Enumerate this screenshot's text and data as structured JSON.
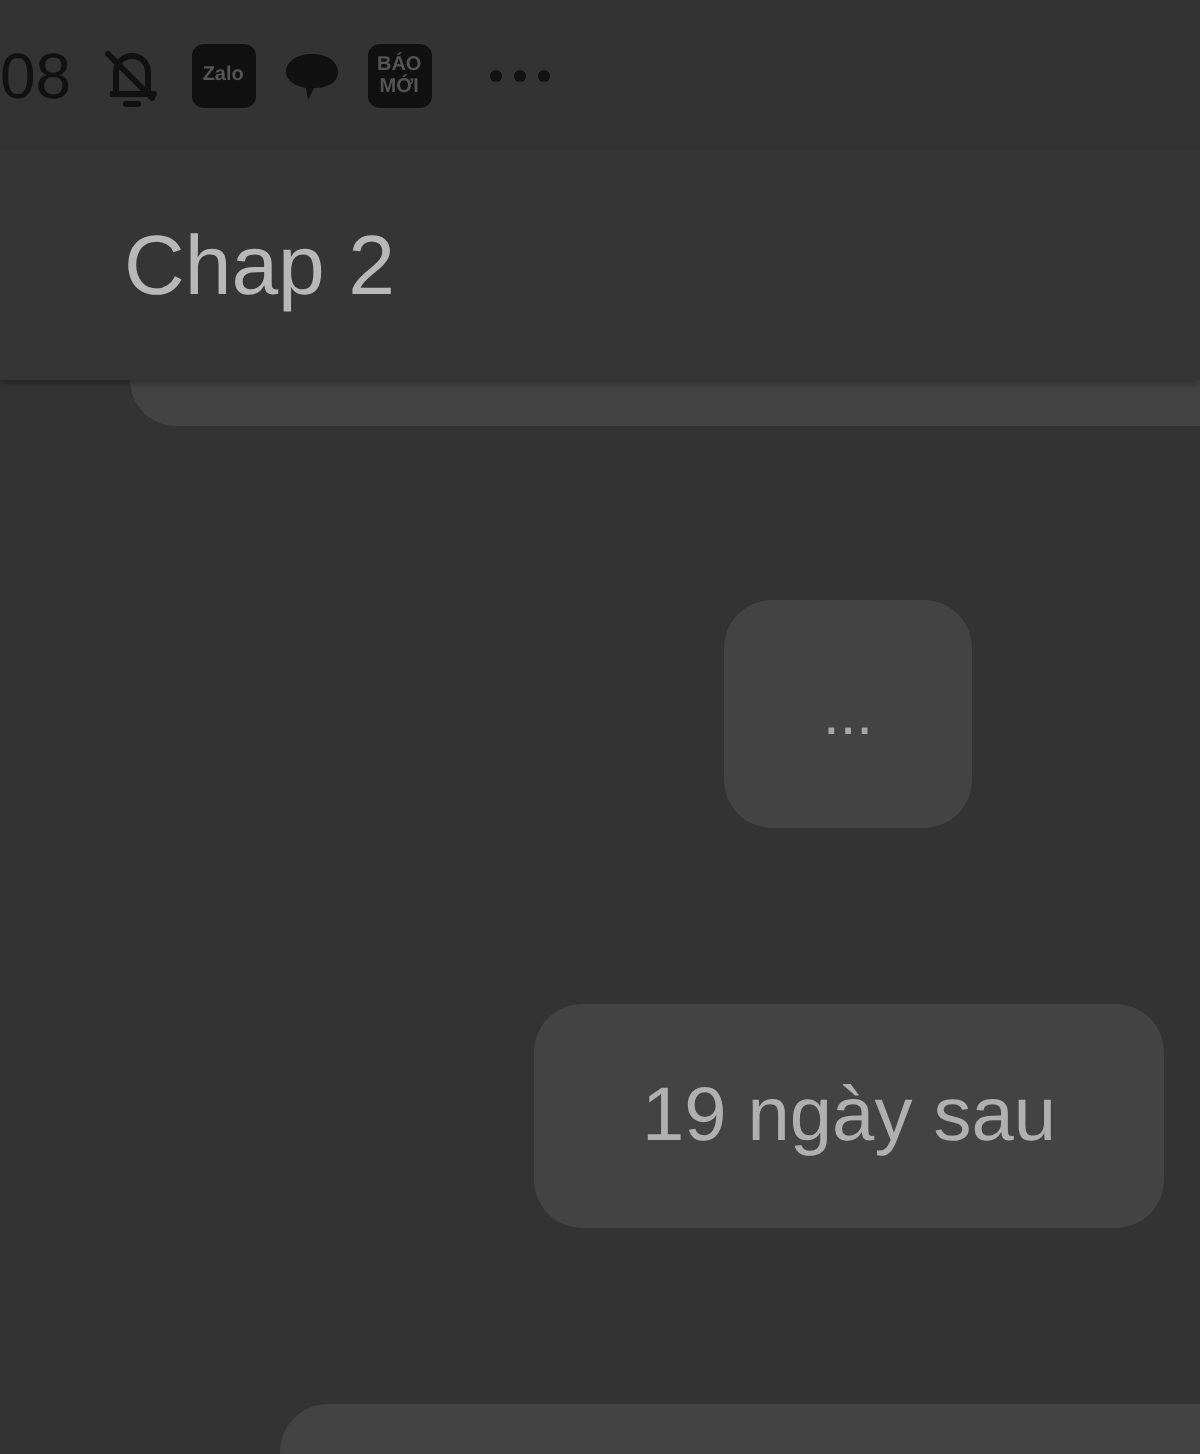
{
  "status_bar": {
    "time": "08",
    "app_icons": [
      {
        "kind": "muted-bell"
      },
      {
        "kind": "badge",
        "label": "Zalo"
      },
      {
        "kind": "chat"
      },
      {
        "kind": "badge",
        "label": "BÁO MỚI"
      }
    ]
  },
  "header": {
    "title": "Chap 2"
  },
  "messages": [
    {
      "text": "..."
    },
    {
      "text": "19 ngày sau"
    }
  ]
}
